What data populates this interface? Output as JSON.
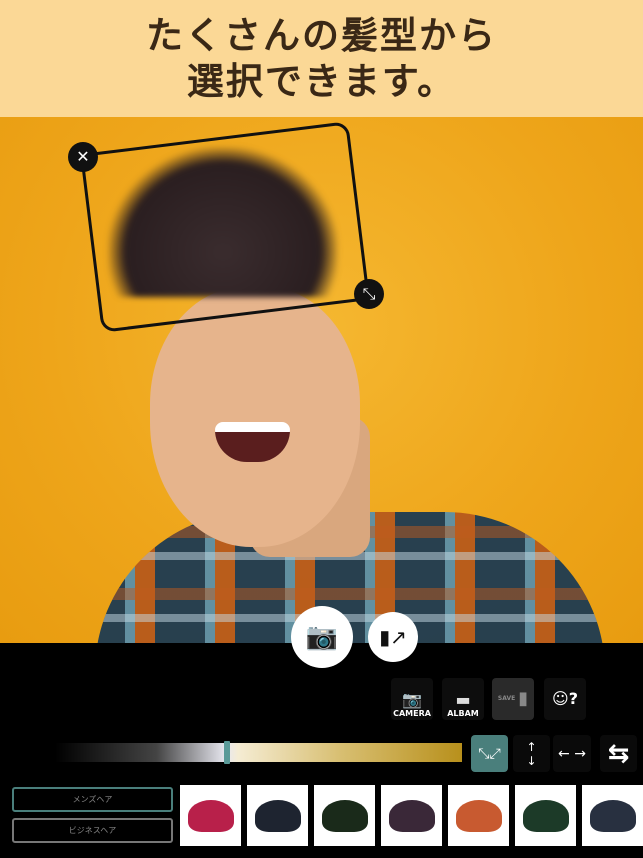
{
  "header": {
    "line1": "たくさんの髪型から",
    "line2": "選択できます。"
  },
  "photo_controls": {
    "close_icon": "close-icon",
    "resize_icon": "resize-diagonal-icon"
  },
  "capture": {
    "camera_icon": "camera-icon",
    "flip_icon": "phone-rotate-icon"
  },
  "tools": {
    "camera_label": "CAMERA",
    "album_label": "ALBAM",
    "save_label": "SAVE"
  },
  "color_slider": {
    "value_percent": 42
  },
  "controls": {
    "expand": "expand-icon",
    "vertical": "up-down-arrows-icon",
    "horizontal": "left-right-arrows-icon",
    "swap": "swap-icon"
  },
  "categories": [
    {
      "label": "メンズヘア",
      "selected": true
    },
    {
      "label": "ビジネスヘア",
      "selected": false
    }
  ],
  "hair_thumbnails": [
    {
      "color": "#b8204a"
    },
    {
      "color": "#1e2430"
    },
    {
      "color": "#1a2a1a"
    },
    {
      "color": "#3a2838"
    },
    {
      "color": "#c85a30"
    },
    {
      "color": "#1c3a28"
    },
    {
      "color": "#283040"
    }
  ],
  "colors": {
    "accent": "#4a7f7c",
    "header_bg": "#fbd896",
    "photo_bg": "#eea51a"
  }
}
